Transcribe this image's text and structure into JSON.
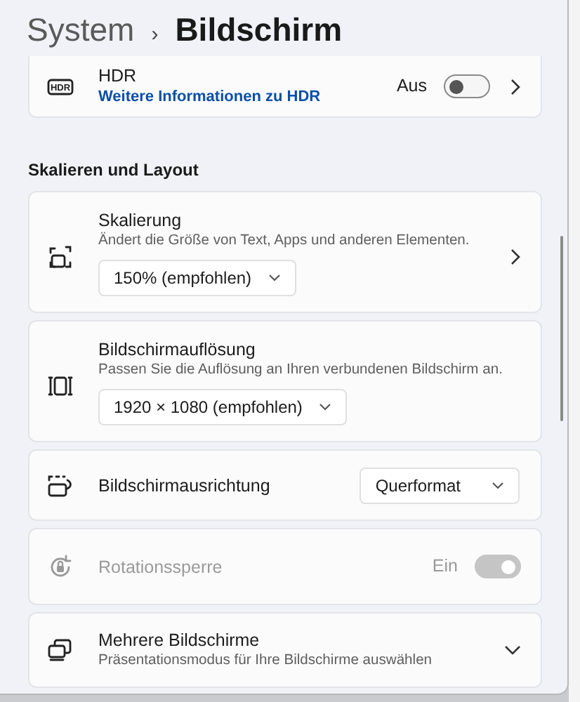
{
  "breadcrumb": {
    "parent": "System",
    "separator": "›",
    "current": "Bildschirm"
  },
  "hdr": {
    "icon_text": "HDR",
    "title": "HDR",
    "link": "Weitere Informationen zu HDR",
    "state": "Aus",
    "on": false
  },
  "section": "Skalieren und Layout",
  "settings": [
    {
      "kind": "navigate_dropdown",
      "title": "Skalierung",
      "subtitle": "Ändert die Größe von Text, Apps und anderen Elementen.",
      "value": "150% (empfohlen)"
    },
    {
      "kind": "dropdown",
      "title": "Bildschirmauflösung",
      "subtitle": "Passen Sie die Auflösung an Ihren verbundenen Bildschirm an.",
      "value": "1920 × 1080 (empfohlen)"
    },
    {
      "kind": "inline_dropdown",
      "title": "Bildschirmausrichtung",
      "value": "Querformat"
    },
    {
      "kind": "toggle",
      "title": "Rotationssperre",
      "state": "Ein",
      "on": true,
      "disabled": true
    },
    {
      "kind": "expander",
      "title": "Mehrere Bildschirme",
      "subtitle": "Präsentationsmodus für Ihre Bildschirme auswählen",
      "expanded": false
    }
  ]
}
